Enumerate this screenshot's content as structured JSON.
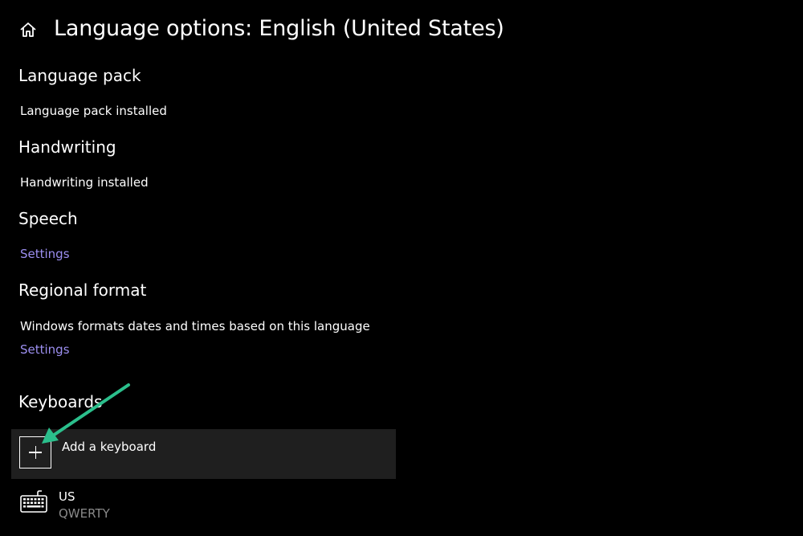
{
  "header": {
    "title": "Language options: English (United States)",
    "home_icon": "home-icon"
  },
  "sections": {
    "language_pack": {
      "title": "Language pack",
      "status": "Language pack installed"
    },
    "handwriting": {
      "title": "Handwriting",
      "status": "Handwriting installed"
    },
    "speech": {
      "title": "Speech",
      "link": "Settings"
    },
    "regional_format": {
      "title": "Regional format",
      "description": "Windows formats dates and times based on this language",
      "link": "Settings"
    },
    "keyboards": {
      "title": "Keyboards",
      "add_label": "Add a keyboard",
      "add_icon": "plus-icon",
      "items": [
        {
          "name": "US",
          "layout": "QWERTY",
          "icon": "keyboard-icon"
        }
      ]
    }
  },
  "colors": {
    "background": "#000000",
    "text": "#ffffff",
    "link": "#9c8ff0",
    "secondary_text": "#8a8a8a",
    "add_button_bg": "#1f1f1f",
    "annotation_arrow": "#2bbf8c"
  }
}
